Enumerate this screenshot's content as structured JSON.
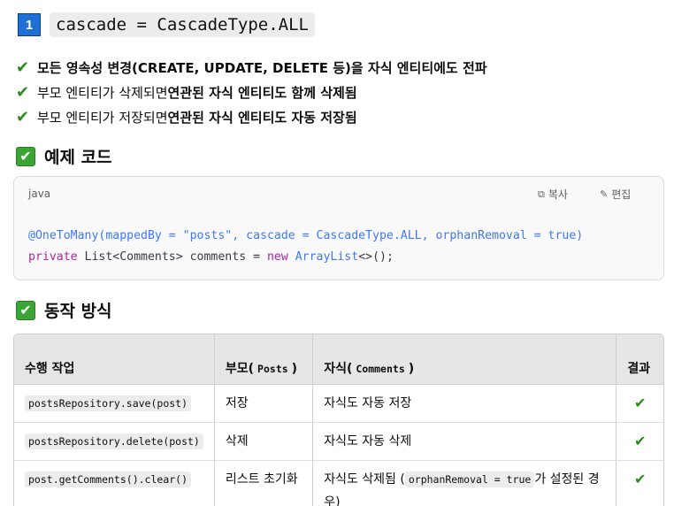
{
  "heading": {
    "number": "1",
    "code": "cascade = CascadeType.ALL"
  },
  "bullets": [
    {
      "plain": "",
      "bold": "모든 영속성 변경(CREATE, UPDATE, DELETE 등)을 자식 엔티티에도 전파"
    },
    {
      "plain": "부모 엔티티가 삭제되면 ",
      "bold": "연관된 자식 엔티티도 함께 삭제됨"
    },
    {
      "plain": "부모 엔티티가 저장되면 ",
      "bold": "연관된 자식 엔티티도 자동 저장됨"
    }
  ],
  "example": {
    "title": "예제 코드",
    "lang": "java",
    "copy": "복사",
    "edit": "편집",
    "line1": "@OneToMany(mappedBy = \"posts\", cascade = CascadeType.ALL, orphanRemoval = true)",
    "line2_kw": "private",
    "line2_mid": " List<Comments> comments = ",
    "line2_new": "new",
    "line2_cls": "ArrayList",
    "line2_end": "<>();"
  },
  "behavior": {
    "title": "동작 방식",
    "headers": {
      "action": "수행 작업",
      "parent": "부모(",
      "parent_code": "Posts",
      "parent_close": ")",
      "child": "자식(",
      "child_code": "Comments",
      "child_close": ")",
      "result": "결과"
    },
    "rows": [
      {
        "action": "postsRepository.save(post)",
        "parent": "저장",
        "child": "자식도 자동 저장",
        "result": "✔"
      },
      {
        "action": "postsRepository.delete(post)",
        "parent": "삭제",
        "child": "자식도 자동 삭제",
        "result": "✔"
      },
      {
        "action": "post.getComments().clear()",
        "parent": "리스트 초기화",
        "child_pre": "자식도 삭제됨 (",
        "child_code": "orphanRemoval = true",
        "child_post": "가 설정된 경우)",
        "result": "✔"
      }
    ]
  }
}
